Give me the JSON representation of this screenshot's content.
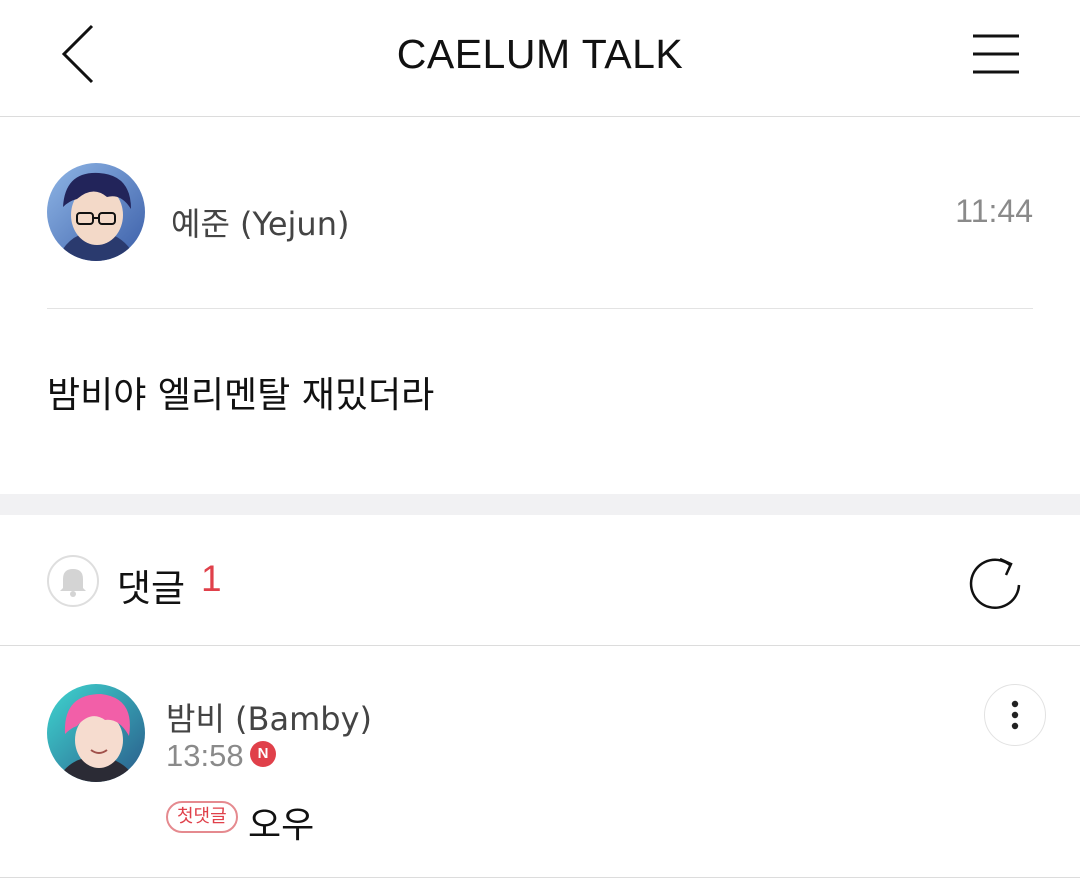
{
  "header": {
    "title": "CAELUM TALK",
    "back_icon": "chevron-left-icon",
    "menu_icon": "hamburger-menu-icon"
  },
  "post": {
    "author": "예준 (Yejun)",
    "time": "11:44",
    "body": "밤비야 엘리멘탈 재밌더라"
  },
  "comments_section": {
    "label": "댓글",
    "count": "1",
    "bell_icon": "bell-icon",
    "refresh_icon": "refresh-icon"
  },
  "comments": [
    {
      "author": "밤비 (Bamby)",
      "time": "13:58",
      "new_badge": "N",
      "first_comment_badge": "첫댓글",
      "text": "오우",
      "more_icon": "more-vertical-icon"
    }
  ],
  "colors": {
    "accent": "#e0404a",
    "divider": "#dcdcdc",
    "section_band": "#f1f1f3"
  }
}
